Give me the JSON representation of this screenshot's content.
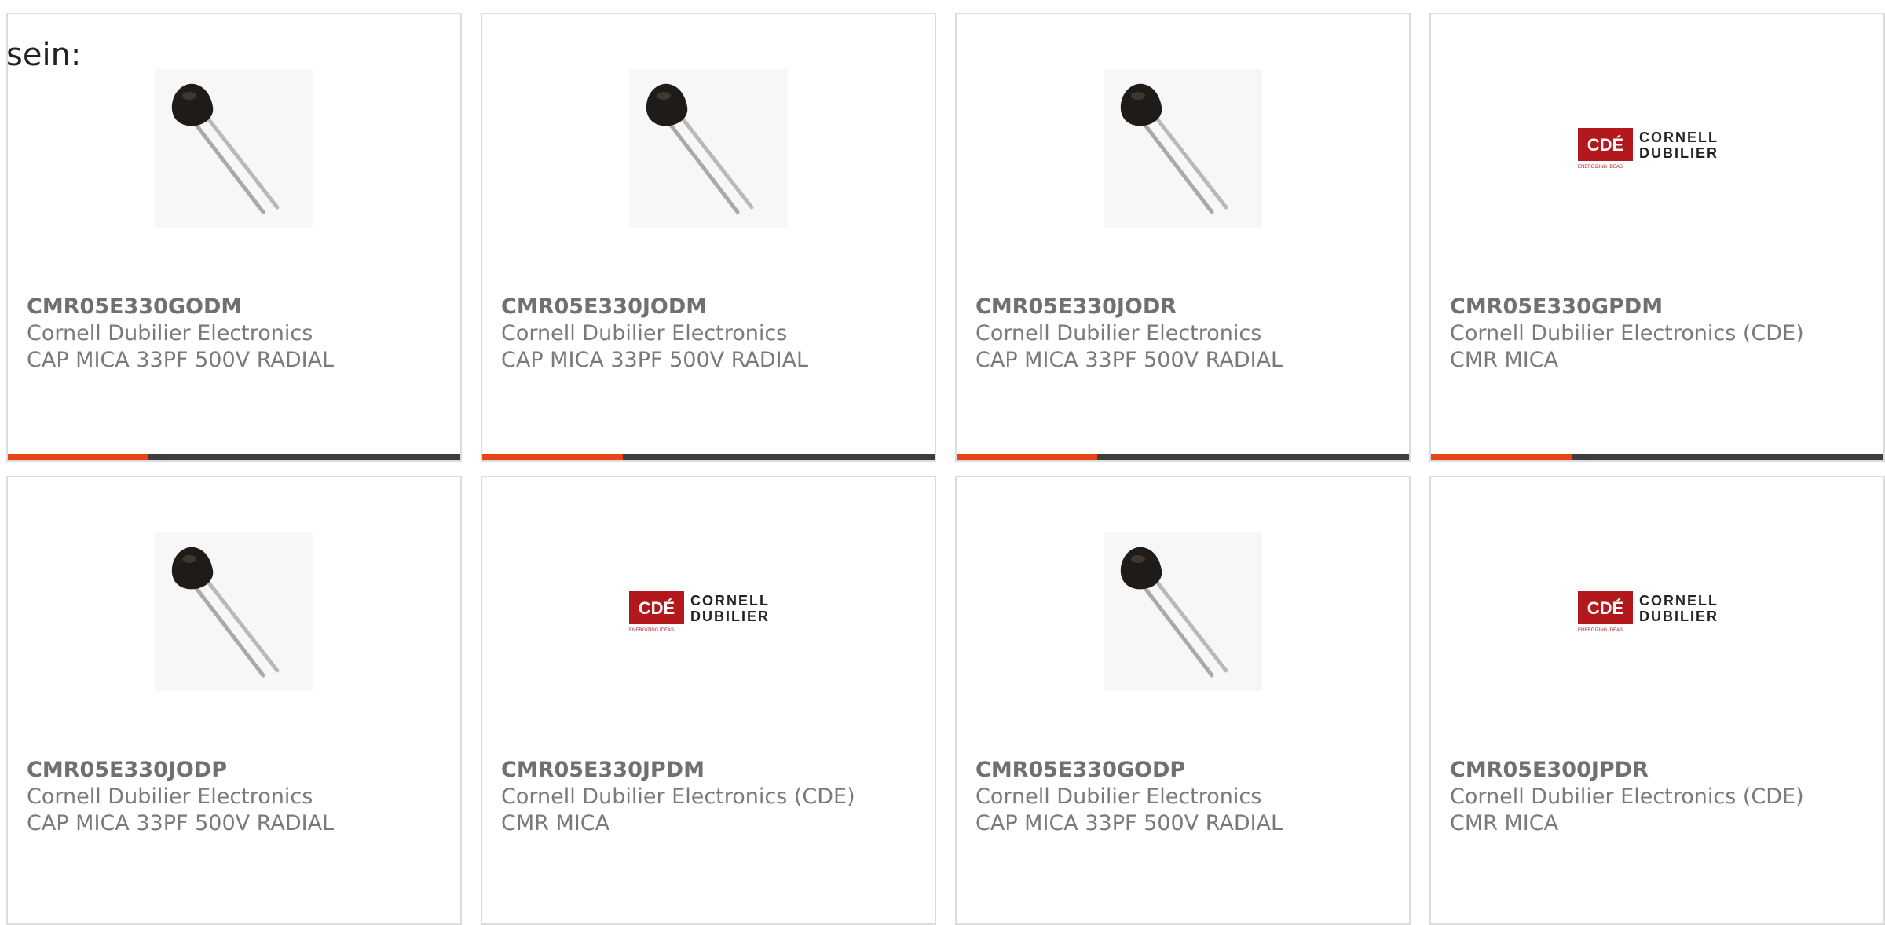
{
  "intro_text": "sein:",
  "colors": {
    "accent": "#e8441a",
    "bar_track": "#3d3d3d",
    "card_border": "#dcdcdc",
    "logo_red": "#b3191c"
  },
  "products": [
    {
      "part_number": "CMR05E330GODM",
      "manufacturer": "Cornell Dubilier Electronics",
      "description": "CAP MICA 33PF 500V RADIAL",
      "image": "capacitor-photo",
      "progress": 0.31
    },
    {
      "part_number": "CMR05E330JODM",
      "manufacturer": "Cornell Dubilier Electronics",
      "description": "CAP MICA 33PF 500V RADIAL",
      "image": "capacitor-photo",
      "progress": 0.31
    },
    {
      "part_number": "CMR05E330JODR",
      "manufacturer": "Cornell Dubilier Electronics",
      "description": "CAP MICA 33PF 500V RADIAL",
      "image": "capacitor-photo",
      "progress": 0.31
    },
    {
      "part_number": "CMR05E330GPDM",
      "manufacturer": "Cornell Dubilier Electronics (CDE)",
      "description": "CMR MICA",
      "image": "cde-logo",
      "progress": 0.31
    },
    {
      "part_number": "CMR05E330JODP",
      "manufacturer": "Cornell Dubilier Electronics",
      "description": "CAP MICA 33PF 500V RADIAL",
      "image": "capacitor-photo"
    },
    {
      "part_number": "CMR05E330JPDM",
      "manufacturer": "Cornell Dubilier Electronics (CDE)",
      "description": "CMR MICA",
      "image": "cde-logo"
    },
    {
      "part_number": "CMR05E330GODP",
      "manufacturer": "Cornell Dubilier Electronics",
      "description": "CAP MICA 33PF 500V RADIAL",
      "image": "capacitor-photo"
    },
    {
      "part_number": "CMR05E300JPDR",
      "manufacturer": "Cornell Dubilier Electronics (CDE)",
      "description": "CMR MICA",
      "image": "cde-logo"
    }
  ],
  "logo": {
    "badge": "CDÉ",
    "line1": "CORNELL",
    "line2": "DUBILIER",
    "tagline": "ENERGIZING IDEAS"
  }
}
